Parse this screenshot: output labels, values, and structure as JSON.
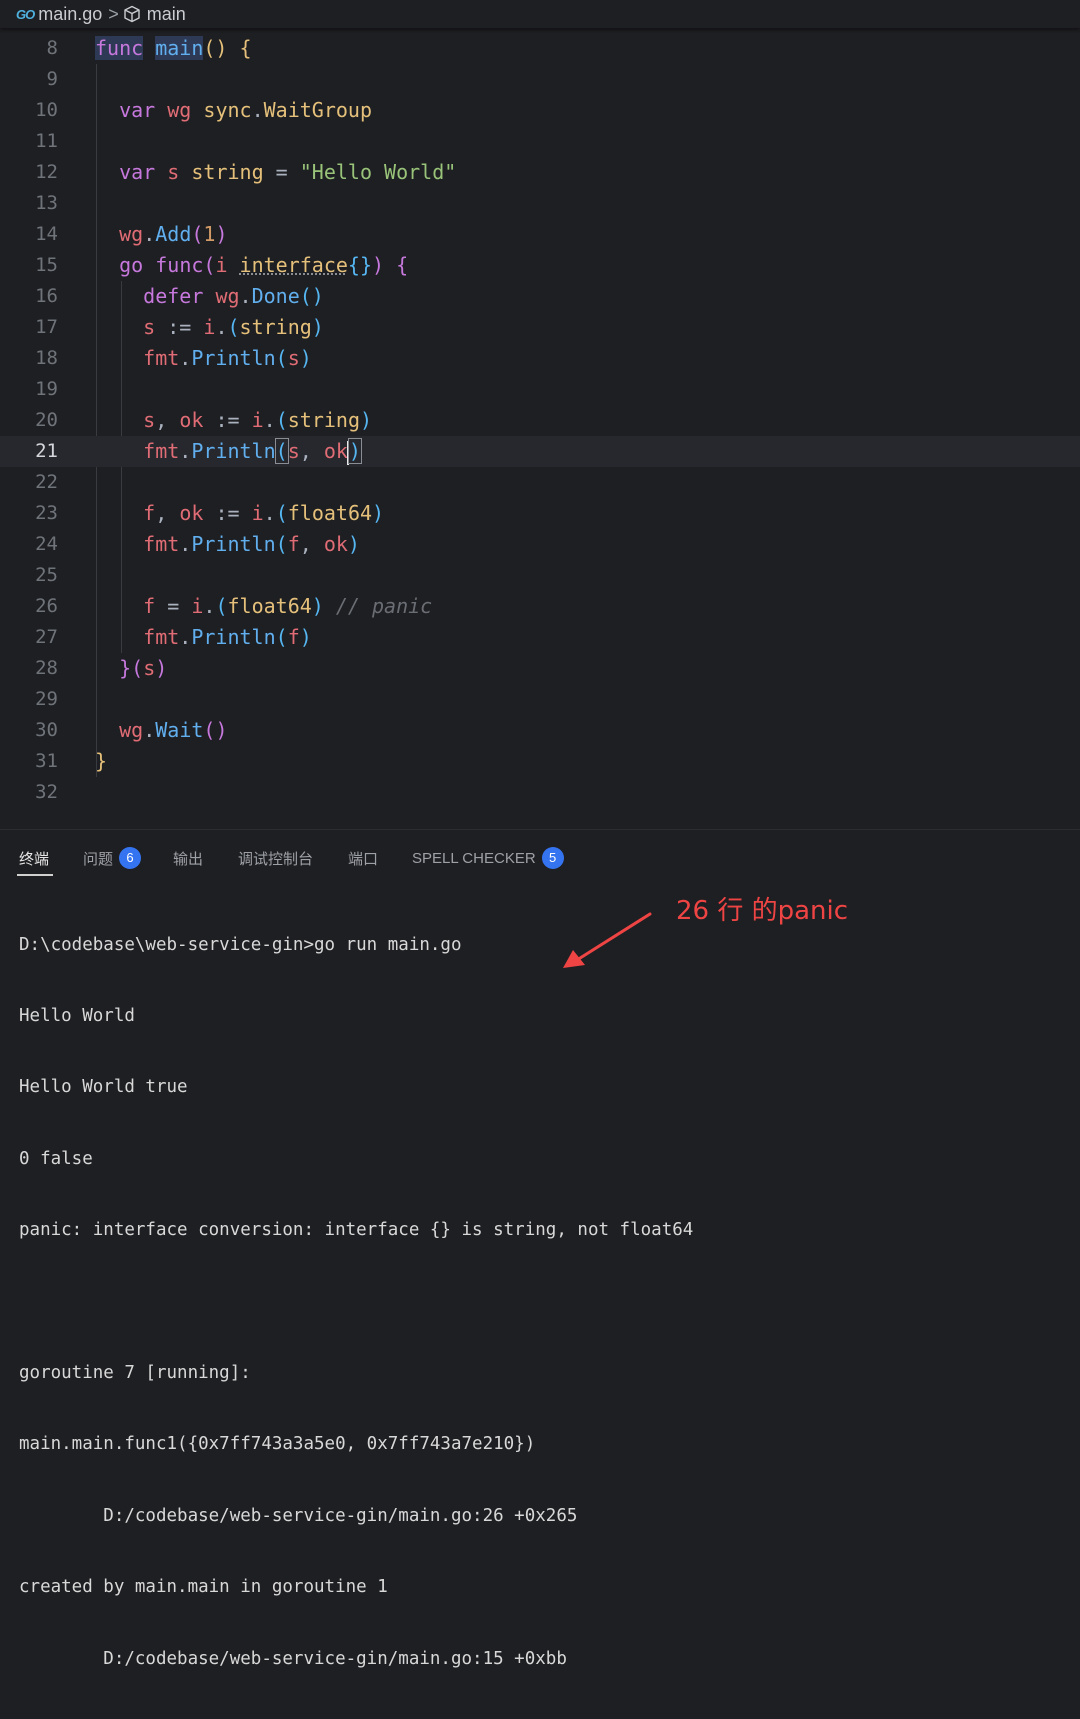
{
  "breadcrumb": {
    "go_logo": "GO",
    "file": "main.go",
    "separator": ">",
    "symbol": "main"
  },
  "editor": {
    "line_numbers": [
      "8",
      "9",
      "10",
      "11",
      "12",
      "13",
      "14",
      "15",
      "16",
      "17",
      "18",
      "19",
      "20",
      "21",
      "22",
      "23",
      "24",
      "25",
      "26",
      "27",
      "28",
      "29",
      "30",
      "31",
      "32"
    ],
    "current_line": "21",
    "comment_panic": "// panic"
  },
  "panel": {
    "tabs": [
      {
        "label": "终端"
      },
      {
        "label": "问题",
        "badge": "6"
      },
      {
        "label": "输出"
      },
      {
        "label": "调试控制台"
      },
      {
        "label": "端口"
      },
      {
        "label": "SPELL CHECKER",
        "badge": "5"
      }
    ]
  },
  "terminal": {
    "lines": [
      "D:\\codebase\\web-service-gin>go run main.go",
      "Hello World",
      "Hello World true",
      "0 false",
      "panic: interface conversion: interface {} is string, not float64",
      "",
      "goroutine 7 [running]:",
      "main.main.func1({0x7ff743a3a5e0, 0x7ff743a7e210})",
      "        D:/codebase/web-service-gin/main.go:26 +0x265",
      "created by main.main in goroutine 1",
      "        D:/codebase/web-service-gin/main.go:15 +0xbb"
    ]
  },
  "annotation": {
    "text": "26 行 的panic",
    "color": "#ef4444"
  },
  "colors": {
    "background": "#1e1f22",
    "keyword": "#c678dd",
    "function": "#61afef",
    "variable": "#e06c75",
    "type": "#e5c07b",
    "string": "#98c379",
    "number": "#d19a66",
    "badge": "#3574f0"
  }
}
